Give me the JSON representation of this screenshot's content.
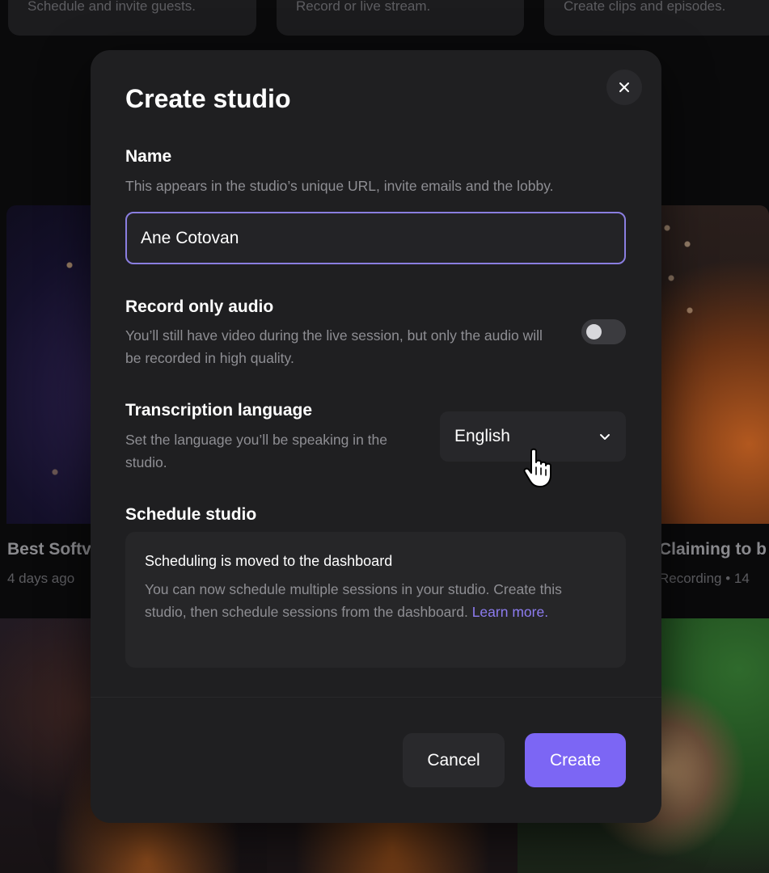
{
  "background": {
    "cards": [
      {
        "text": "Schedule and invite guests."
      },
      {
        "text": "Record or live stream."
      },
      {
        "text": "Create clips and episodes."
      }
    ],
    "videos": [
      {
        "title": "Best Softv",
        "meta": "4 days ago"
      },
      {
        "title": "Claiming to b",
        "meta": "Recording • 14"
      }
    ]
  },
  "modal": {
    "title": "Create studio",
    "close_icon": "close-icon",
    "name": {
      "label": "Name",
      "help": "This appears in the studio’s unique URL, invite emails and the lobby.",
      "value": "Ane Cotovan"
    },
    "record_audio": {
      "label": "Record only audio",
      "help": "You’ll still have video during the live session, but only the audio will be recorded in high quality.",
      "enabled": false
    },
    "transcription": {
      "label": "Transcription language",
      "help": "Set the language you’ll be speaking in the studio.",
      "selected": "English",
      "icon": "chevron-down-icon"
    },
    "schedule": {
      "label": "Schedule studio",
      "info_title": "Scheduling is moved to the dashboard",
      "info_body": "You can now schedule multiple sessions in your studio. Create this studio, then schedule sessions from the dashboard.",
      "learn_more": "Learn more."
    },
    "buttons": {
      "cancel": "Cancel",
      "create": "Create"
    }
  },
  "colors": {
    "accent": "#7c66f4",
    "input_border": "#8a7ee0",
    "link": "#8d7cf0",
    "modal_bg": "#1f1f21"
  }
}
